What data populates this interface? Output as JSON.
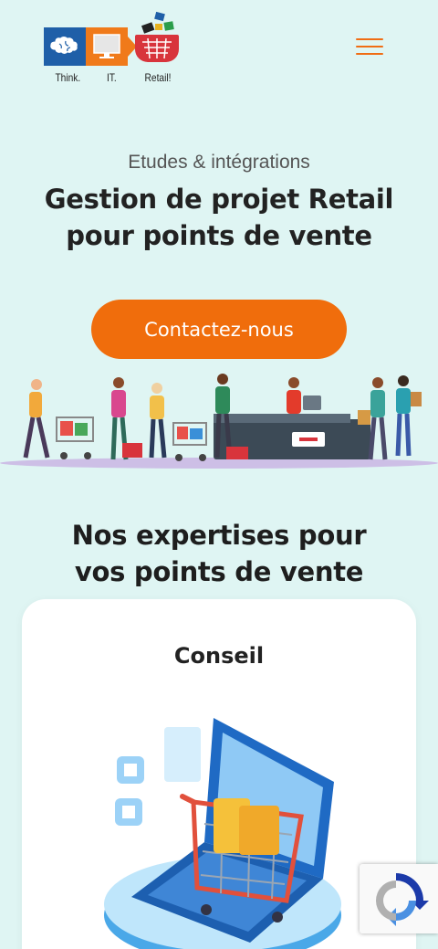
{
  "header": {
    "logo": {
      "words": [
        "Think.",
        "IT.",
        "Retail!"
      ],
      "icons": [
        "brain-icon",
        "monitor-icon",
        "basket-icon"
      ]
    },
    "menu_icon": "hamburger-icon"
  },
  "hero": {
    "eyebrow": "Etudes & intégrations",
    "title_line1": "Gestion de projet Retail",
    "title_line2": "pour points de vente",
    "cta_label": "Contactez-nous"
  },
  "expertises": {
    "title_line1": "Nos expertises pour",
    "title_line2": "vos points de vente",
    "cards": [
      {
        "title": "Conseil"
      }
    ]
  },
  "colors": {
    "background": "#dff5f3",
    "accent": "#f06d0c",
    "text": "#222222"
  }
}
